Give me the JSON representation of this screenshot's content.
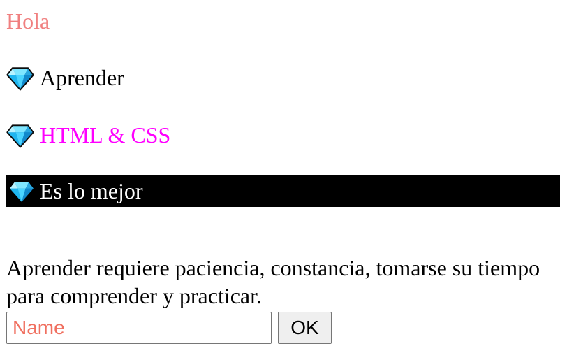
{
  "heading": {
    "text": "Hola",
    "color": "#f08080"
  },
  "list": {
    "icon": "gem-icon",
    "items": [
      {
        "label": "Aprender",
        "color": "#000000"
      },
      {
        "label": "HTML & CSS",
        "color": "#ff00ff"
      },
      {
        "label": "Es lo mejor",
        "color": "#ffffff",
        "background": "#000000"
      }
    ]
  },
  "paragraph": {
    "text": "Aprender requiere paciencia, constancia, tomarse su tiempo para comprender y practicar."
  },
  "form": {
    "name_placeholder": "Name",
    "name_value": "",
    "placeholder_color": "#f07060",
    "ok_label": "OK"
  }
}
